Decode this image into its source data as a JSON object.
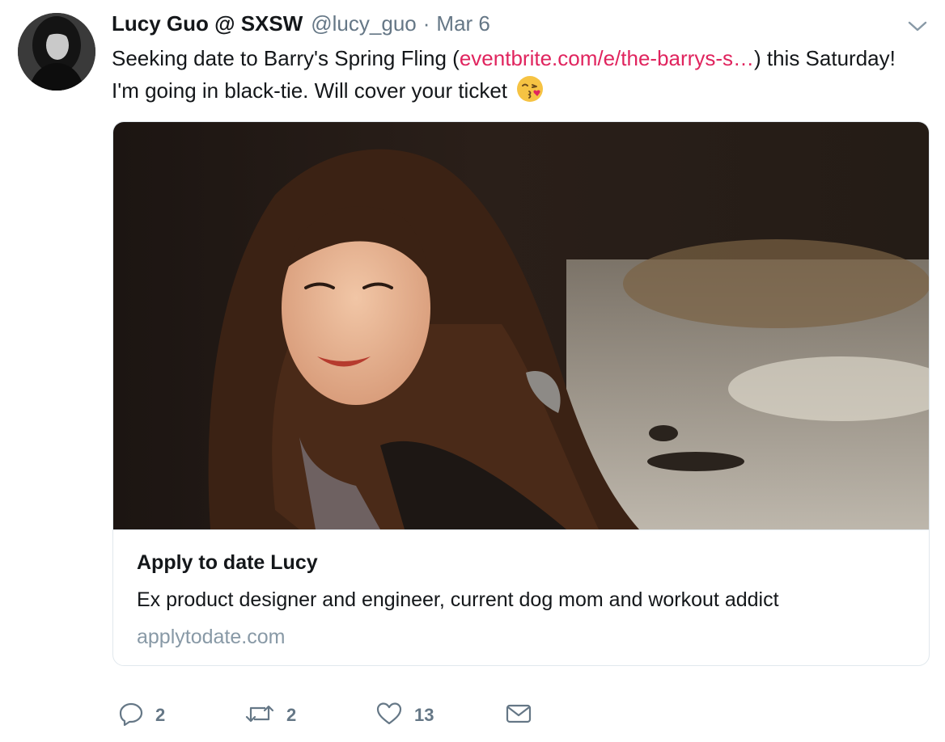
{
  "tweet": {
    "author": {
      "display_name": "Lucy Guo @ SXSW",
      "handle": "@lucy_guo"
    },
    "separator": "·",
    "date": "Mar 6",
    "text_before_link": "Seeking date to Barry's Spring Fling (",
    "link_text": "eventbrite.com/e/the-barrys-s…",
    "text_after_link": ") this Saturday! I'm going in black-tie. Will cover your ticket",
    "emoji": "kissing-winking-face-emoji"
  },
  "card": {
    "title": "Apply to date Lucy",
    "description": "Ex product designer and engineer, current dog mom and workout addict",
    "domain": "applytodate.com"
  },
  "actions": {
    "replies": "2",
    "retweets": "2",
    "likes": "13"
  },
  "icons": [
    "chevron-down-icon",
    "reply-icon",
    "retweet-icon",
    "like-icon",
    "direct-message-icon"
  ],
  "colors": {
    "link": "#e0245e",
    "secondary_text": "#657786",
    "card_border": "#e1e8ed"
  }
}
